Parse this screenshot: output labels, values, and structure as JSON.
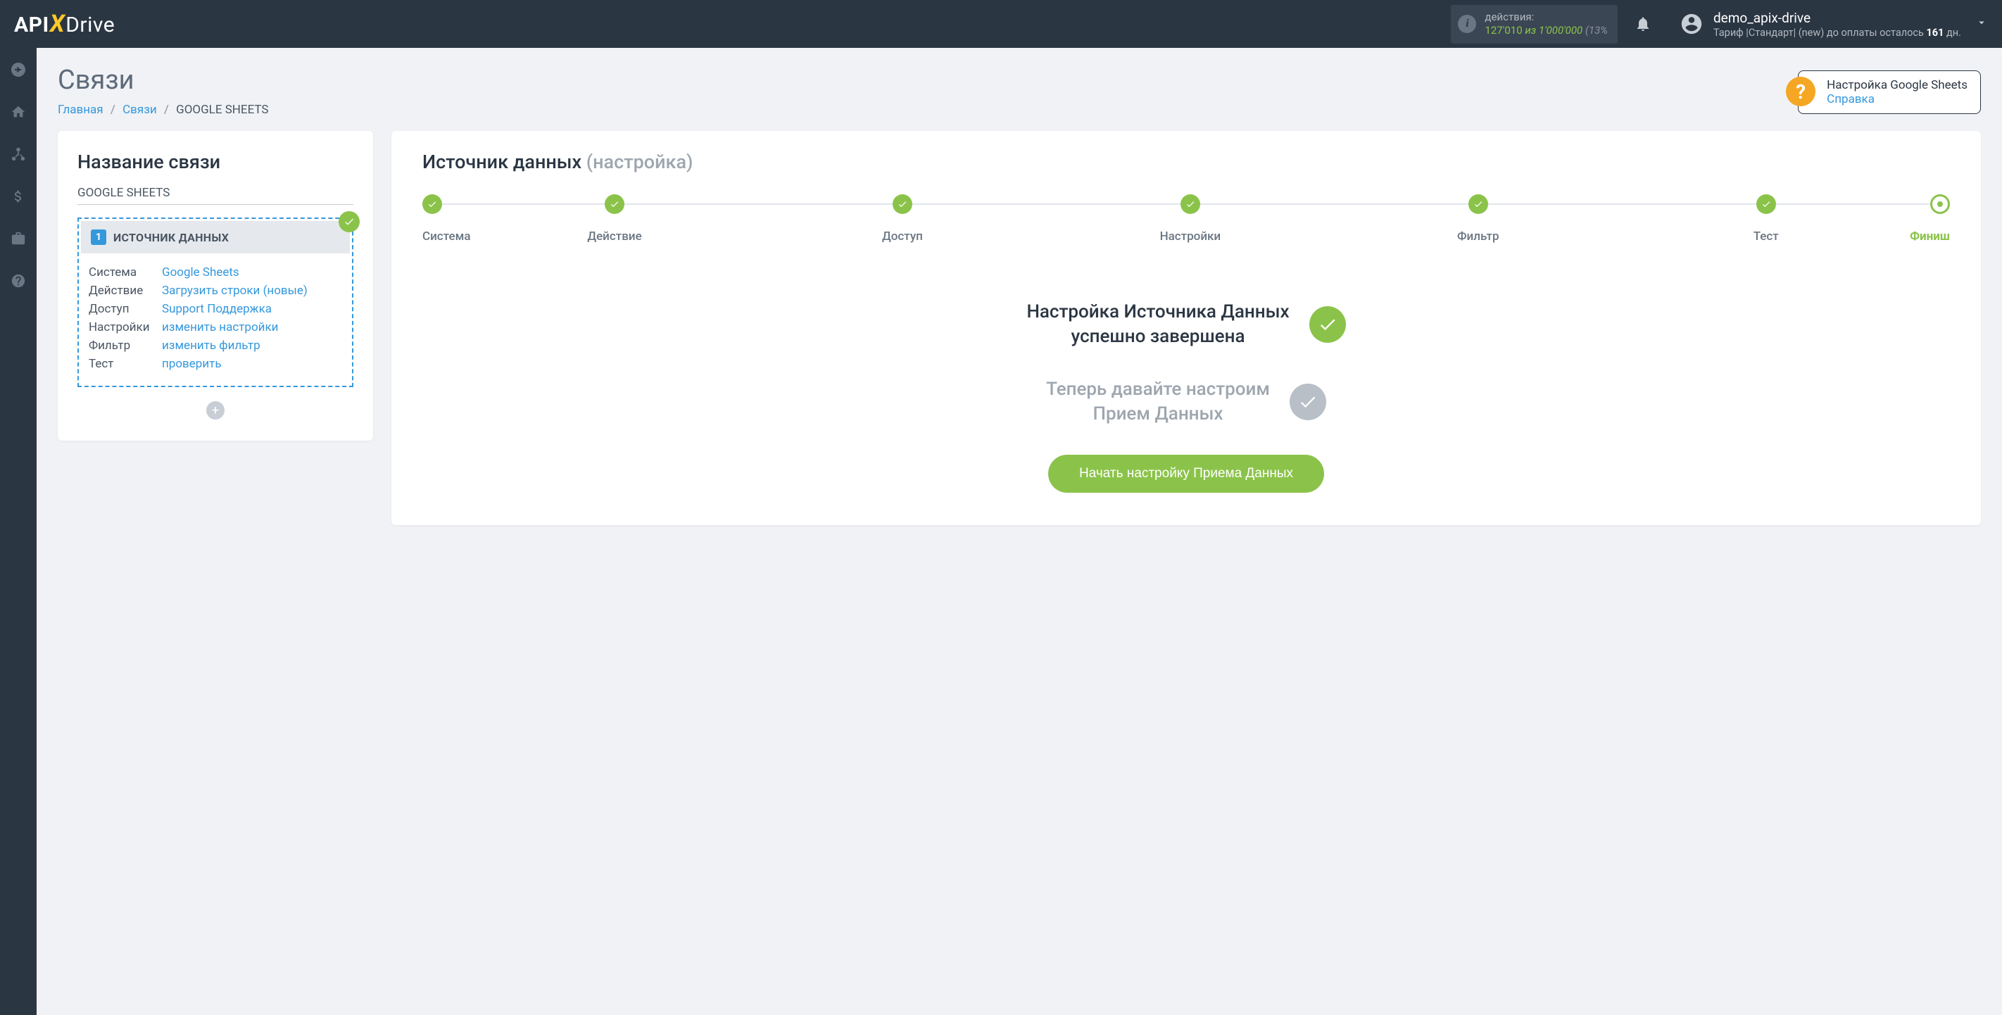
{
  "header": {
    "logo": {
      "api": "API",
      "x": "X",
      "drive": "Drive"
    },
    "actions": {
      "label": "действия:",
      "count": "127'010",
      "of": "из",
      "total": "1'000'000",
      "pct": "(13%"
    },
    "user": {
      "name": "demo_apix-drive",
      "tariff_prefix": "Тариф |Стандарт| (new) до оплаты осталось ",
      "tariff_days": "161",
      "tariff_suffix": " дн."
    }
  },
  "page": {
    "title": "Связи",
    "breadcrumb": {
      "home": "Главная",
      "links": "Связи",
      "current": "GOOGLE SHEETS"
    }
  },
  "help": {
    "title": "Настройка Google Sheets",
    "link": "Справка"
  },
  "left_card": {
    "title": "Название связи",
    "conn_name": "GOOGLE SHEETS",
    "source": {
      "num": "1",
      "header": "ИСТОЧНИК ДАННЫХ",
      "rows": [
        {
          "lbl": "Система",
          "val": "Google Sheets"
        },
        {
          "lbl": "Действие",
          "val": "Загрузить строки (новые)"
        },
        {
          "lbl": "Доступ",
          "val": "Support Поддержка"
        },
        {
          "lbl": "Настройки",
          "val": "изменить настройки"
        },
        {
          "lbl": "Фильтр",
          "val": "изменить фильтр"
        },
        {
          "lbl": "Тест",
          "val": "проверить"
        }
      ]
    }
  },
  "right_card": {
    "title": "Источник данных",
    "subtitle": "(настройка)",
    "steps": [
      "Система",
      "Действие",
      "Доступ",
      "Настройки",
      "Фильтр",
      "Тест",
      "Финиш"
    ],
    "status1_l1": "Настройка Источника Данных",
    "status1_l2": "успешно завершена",
    "status2_l1": "Теперь давайте настроим",
    "status2_l2": "Прием Данных",
    "button": "Начать настройку Приема Данных"
  }
}
